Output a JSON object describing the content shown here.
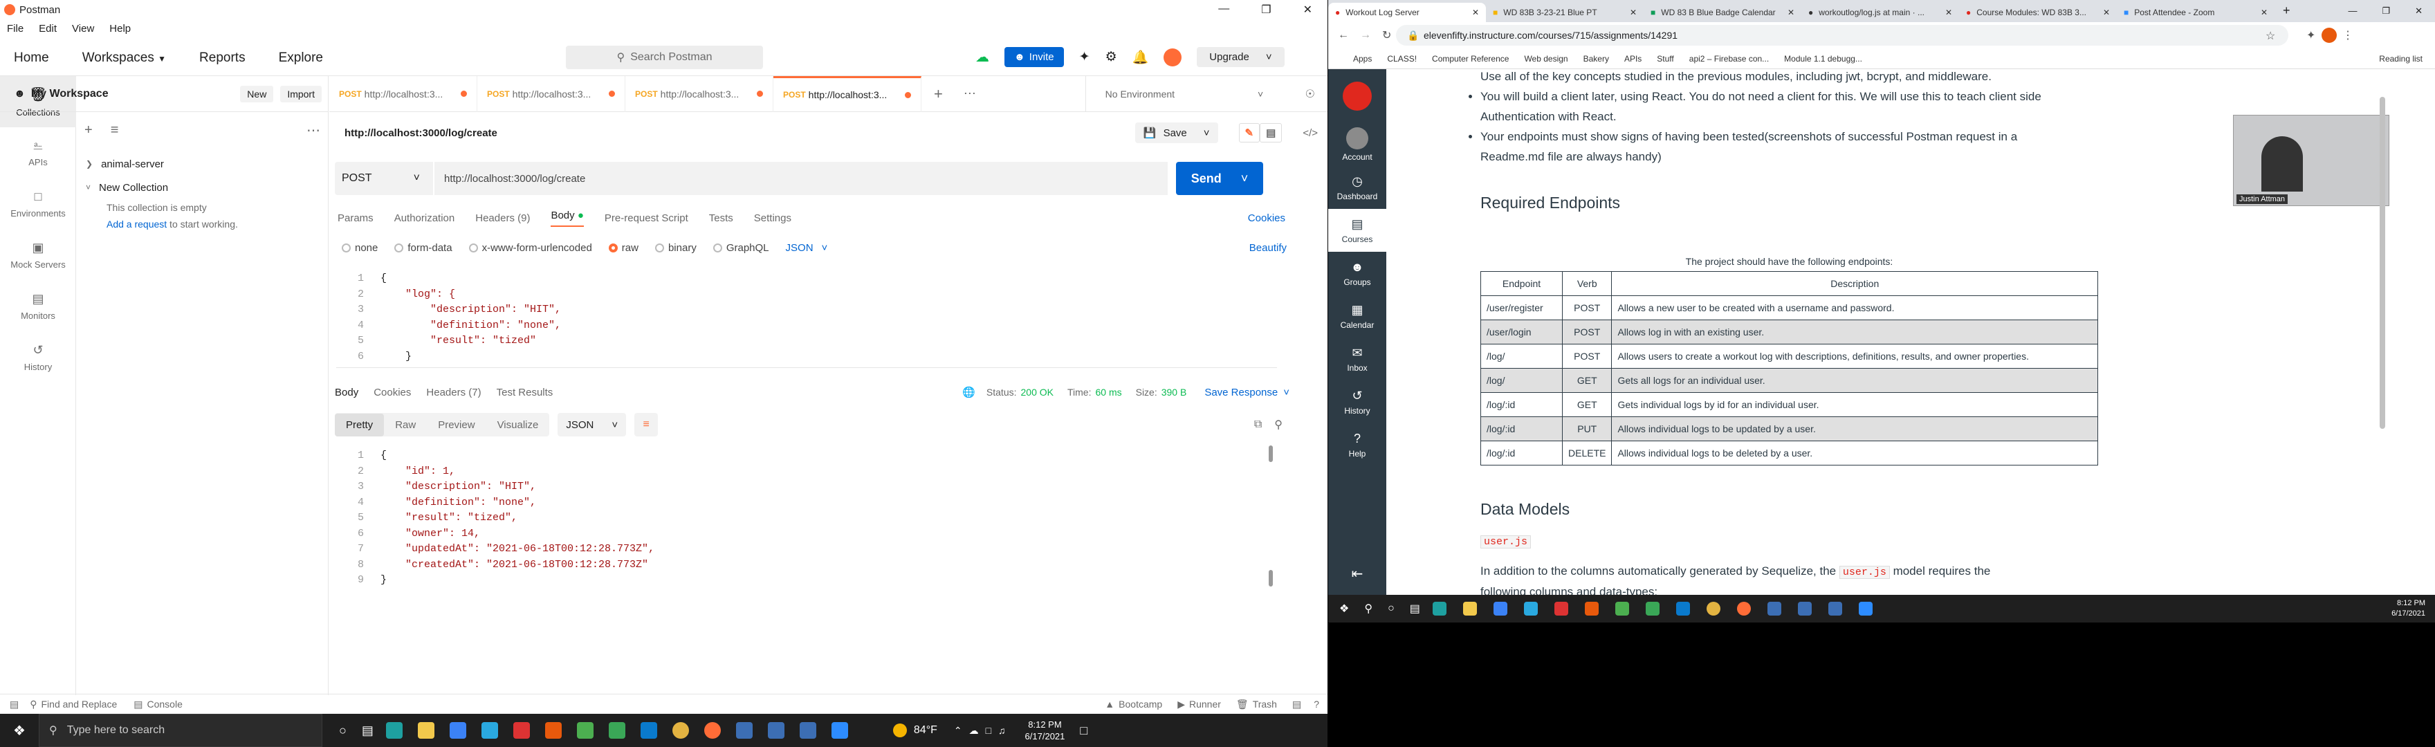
{
  "postman": {
    "window_title": "Postman",
    "menu": [
      "File",
      "Edit",
      "View",
      "Help"
    ],
    "nav": [
      "Home",
      "Workspaces",
      "Reports",
      "Explore"
    ],
    "search_placeholder": "Search Postman",
    "invite_label": "Invite",
    "upgrade_label": "Upgrade",
    "rail": [
      "Collections",
      "APIs",
      "Environments",
      "Mock Servers",
      "Monitors",
      "History"
    ],
    "workspace": {
      "name": "My Workspace",
      "new_label": "New",
      "import_label": "Import"
    },
    "collections": [
      {
        "name": "animal-server",
        "expanded": false
      },
      {
        "name": "New Collection",
        "expanded": true,
        "empty_text": "This collection is empty",
        "add_link": "Add a request",
        "add_suffix": " to start working."
      }
    ],
    "tabs": [
      {
        "method": "POST",
        "url": "http://localhost:3..."
      },
      {
        "method": "POST",
        "url": "http://localhost:3..."
      },
      {
        "method": "POST",
        "url": "http://localhost:3..."
      },
      {
        "method": "POST",
        "url": "http://localhost:3..."
      }
    ],
    "environment": "No Environment",
    "request_title": "http://localhost:3000/log/create",
    "save_label": "Save",
    "method": "POST",
    "request_url": "http://localhost:3000/log/create",
    "send_label": "Send",
    "req_tabs": [
      "Params",
      "Authorization",
      "Headers (9)",
      "Body",
      "Pre-request Script",
      "Tests",
      "Settings"
    ],
    "cookies_label": "Cookies",
    "body_types": [
      "none",
      "form-data",
      "x-www-form-urlencoded",
      "raw",
      "binary",
      "GraphQL"
    ],
    "body_format": "JSON",
    "beautify_label": "Beautify",
    "request_body": [
      "{",
      "    \"log\": {",
      "        \"description\": \"HIT\",",
      "        \"definition\": \"none\",",
      "        \"result\": \"tized\"",
      "    }"
    ],
    "resp_tabs": [
      "Body",
      "Cookies",
      "Headers (7)",
      "Test Results"
    ],
    "status": {
      "status_label": "Status:",
      "status": "200 OK",
      "time_label": "Time:",
      "time": "60 ms",
      "size_label": "Size:",
      "size": "390 B"
    },
    "save_response": "Save Response",
    "view_modes": [
      "Pretty",
      "Raw",
      "Preview",
      "Visualize"
    ],
    "response_format": "JSON",
    "response_body": [
      "{",
      "    \"id\": 1,",
      "    \"description\": \"HIT\",",
      "    \"definition\": \"none\",",
      "    \"result\": \"tized\",",
      "    \"owner\": 14,",
      "    \"updatedAt\": \"2021-06-18T00:12:28.773Z\",",
      "    \"createdAt\": \"2021-06-18T00:12:28.773Z\"",
      "}"
    ],
    "statusbar": {
      "find": "Find and Replace",
      "console": "Console",
      "bootcamp": "Bootcamp",
      "runner": "Runner",
      "trash": "Trash"
    }
  },
  "taskbar": {
    "search_placeholder": "Type here to search",
    "weather": "84°F",
    "time": "8:12 PM",
    "date": "6/17/2021"
  },
  "browser": {
    "tabs": [
      "Workout Log Server",
      "WD 83B 3-23-21 Blue PT",
      "WD 83 B Blue Badge Calendar",
      "workoutlog/log.js at main · ...",
      "Course Modules: WD 83B 3...",
      "Post Attendee - Zoom"
    ],
    "url": "elevenfifty.instructure.com/courses/715/assignments/14291",
    "bookmarks": [
      "Apps",
      "CLASS!",
      "Computer Reference",
      "Web design",
      "Bakery",
      "APIs",
      "Stuff",
      "api2 – Firebase con...",
      "Module 1.1 debugg..."
    ],
    "reading_list": "Reading list",
    "canvas_nav": [
      "Account",
      "Dashboard",
      "Courses",
      "Groups",
      "Calendar",
      "Inbox",
      "History",
      "Help"
    ],
    "bullets": [
      "Use all of the key concepts studied in the previous modules, including jwt, bcrypt, and middleware.",
      "You will build a client later, using React. You do not need a client for this. We will use this to teach client side Authentication with React.",
      "Your endpoints must show signs of having been tested(screenshots of successful Postman request in a Readme.md file are always handy)"
    ],
    "video_name": "Justin Attman",
    "endpoints_heading": "Required Endpoints",
    "table_caption": "The project should have the following endpoints:",
    "table_headers": [
      "Endpoint",
      "Verb",
      "Description"
    ],
    "table_rows": [
      [
        "/user/register",
        "POST",
        "Allows a new user to be created with a username and password."
      ],
      [
        "/user/login",
        "POST",
        "Allows log in with an existing user."
      ],
      [
        "/log/",
        "POST",
        "Allows users to create a workout log with descriptions, definitions, results, and owner properties."
      ],
      [
        "/log/",
        "GET",
        "Gets all logs for an individual user."
      ],
      [
        "/log/:id",
        "GET",
        "Gets individual logs by id for an individual user."
      ],
      [
        "/log/:id",
        "PUT",
        "Allows individual logs to be updated by a user."
      ],
      [
        "/log/:id",
        "DELETE",
        "Allows individual logs to be deleted by a user."
      ]
    ],
    "models_heading": "Data Models",
    "model_file": "user.js",
    "models_text_pre": "In addition to the columns automatically generated by Sequelize, the ",
    "models_text_code": "user.js",
    "models_text_post": " model requires the",
    "models_text_2": "following columns and data-types:"
  },
  "colors": {
    "postman_orange": "#ff6c37",
    "send_blue": "#0265d2",
    "canvas_nav": "#2d3b45",
    "status_green": "#0cbb52"
  }
}
